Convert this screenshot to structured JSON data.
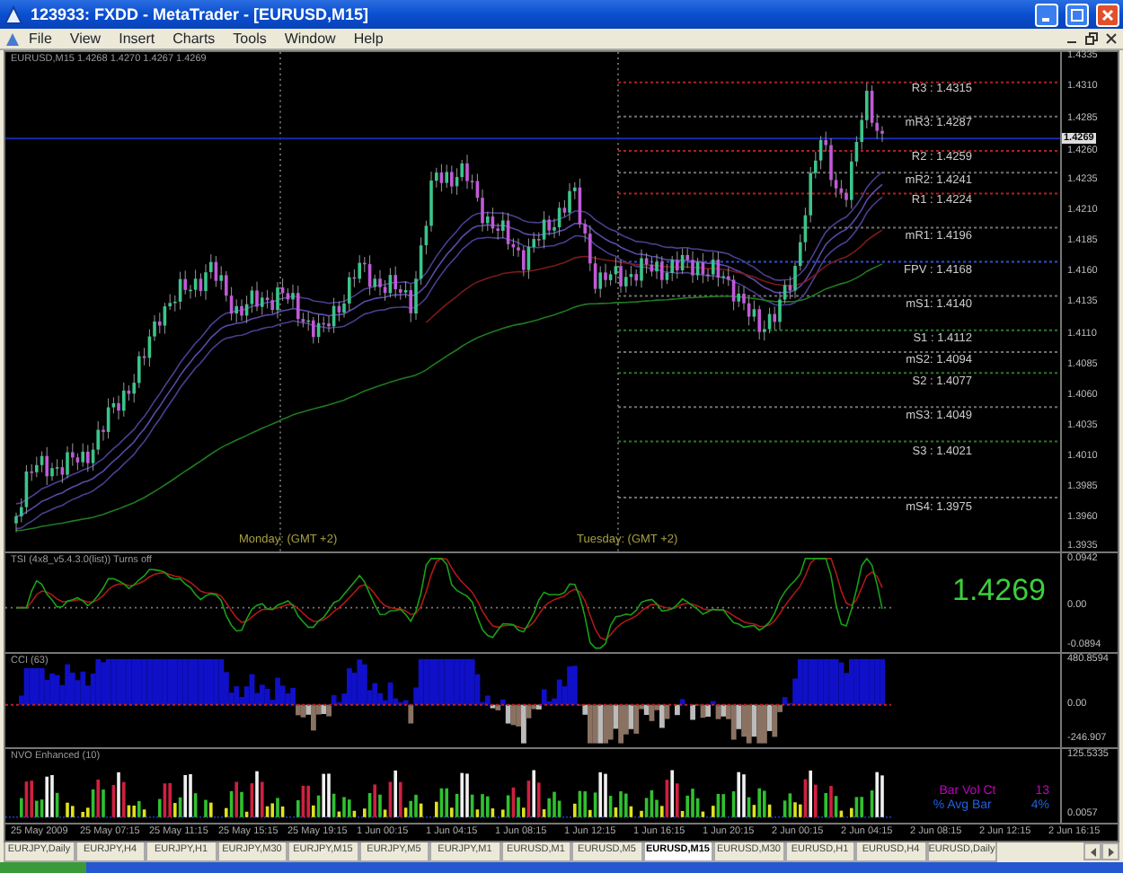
{
  "window": {
    "title": "123933: FXDD - MetaTrader - [EURUSD,M15]"
  },
  "menu": [
    "File",
    "View",
    "Insert",
    "Charts",
    "Tools",
    "Window",
    "Help"
  ],
  "chart": {
    "caption": "EURUSD,M15  1.4268 1.4270 1.4267 1.4269",
    "price_axis": [
      "1.4335",
      "1.4310",
      "1.4285",
      "1.4260",
      "1.4235",
      "1.4210",
      "1.4185",
      "1.4160",
      "1.4135",
      "1.4110",
      "1.4085",
      "1.4060",
      "1.4035",
      "1.4010",
      "1.3985",
      "1.3960",
      "1.3935"
    ],
    "current_price": "1.4269",
    "sessions": [
      "Monday:  (GMT +2)",
      "Tuesday:  (GMT +2)"
    ],
    "pivots": [
      {
        "label": "R3 : 1.4315",
        "kind": "resistance"
      },
      {
        "label": "mR3: 1.4287",
        "kind": "mid"
      },
      {
        "label": "R2 : 1.4259",
        "kind": "resistance"
      },
      {
        "label": "mR2: 1.4241",
        "kind": "mid"
      },
      {
        "label": "R1 : 1.4224",
        "kind": "resistance"
      },
      {
        "label": "mR1: 1.4196",
        "kind": "mid"
      },
      {
        "label": "FPV : 1.4168",
        "kind": "pivot"
      },
      {
        "label": "mS1: 1.4140",
        "kind": "mid"
      },
      {
        "label": "S1 : 1.4112",
        "kind": "support"
      },
      {
        "label": "mS2: 1.4094",
        "kind": "mid"
      },
      {
        "label": "S2 : 1.4077",
        "kind": "support"
      },
      {
        "label": "mS3: 1.4049",
        "kind": "mid"
      },
      {
        "label": "S3 : 1.4021",
        "kind": "support"
      },
      {
        "label": "mS4: 1.3975",
        "kind": "mid"
      }
    ]
  },
  "tsi": {
    "caption": "TSI (4x8_v5.4.3.0(list)) Turns off",
    "big_price": "1.4269",
    "axis": [
      {
        "text": "0.0942",
        "kind": "max"
      },
      {
        "text": "0.00",
        "kind": "zero"
      },
      {
        "text": "-0.0894",
        "kind": "min"
      }
    ]
  },
  "cci": {
    "caption": "CCI (63)",
    "axis": [
      {
        "text": "480.8594",
        "kind": "max"
      },
      {
        "text": "0.00",
        "kind": "zero"
      },
      {
        "text": "-246.907",
        "kind": "min"
      }
    ]
  },
  "volume": {
    "caption": "NVO Enhanced (10)",
    "axis": [
      {
        "text": "125.5335",
        "kind": "max"
      },
      {
        "text": "0.0057",
        "kind": "min"
      }
    ],
    "stats": [
      {
        "label": "Bar Vol Ct",
        "value": "13",
        "color": "#c000c0"
      },
      {
        "label": "% Avg Bar",
        "value": "4%",
        "color": "#2060e0"
      }
    ]
  },
  "time_axis": [
    "25 May 2009",
    "25 May 07:15",
    "25 May 11:15",
    "25 May 15:15",
    "25 May 19:15",
    "1 Jun 00:15",
    "1 Jun 04:15",
    "1 Jun 08:15",
    "1 Jun 12:15",
    "1 Jun 16:15",
    "1 Jun 20:15",
    "2 Jun 00:15",
    "2 Jun 04:15",
    "2 Jun 08:15",
    "2 Jun 12:15",
    "2 Jun 16:15"
  ],
  "tabs": [
    {
      "label": "EURJPY,Daily",
      "selected": false
    },
    {
      "label": "EURJPY,H4",
      "selected": false
    },
    {
      "label": "EURJPY,H1",
      "selected": false
    },
    {
      "label": "EURJPY,M30",
      "selected": false
    },
    {
      "label": "EURJPY,M15",
      "selected": false
    },
    {
      "label": "EURJPY,M5",
      "selected": false
    },
    {
      "label": "EURJPY,M1",
      "selected": false
    },
    {
      "label": "EURUSD,M1",
      "selected": false
    },
    {
      "label": "EURUSD,M5",
      "selected": false
    },
    {
      "label": "EURUSD,M15",
      "selected": true
    },
    {
      "label": "EURUSD,M30",
      "selected": false
    },
    {
      "label": "EURUSD,H1",
      "selected": false
    },
    {
      "label": "EURUSD,H4",
      "selected": false
    },
    {
      "label": "EURUSD,Daily",
      "selected": false
    }
  ]
}
